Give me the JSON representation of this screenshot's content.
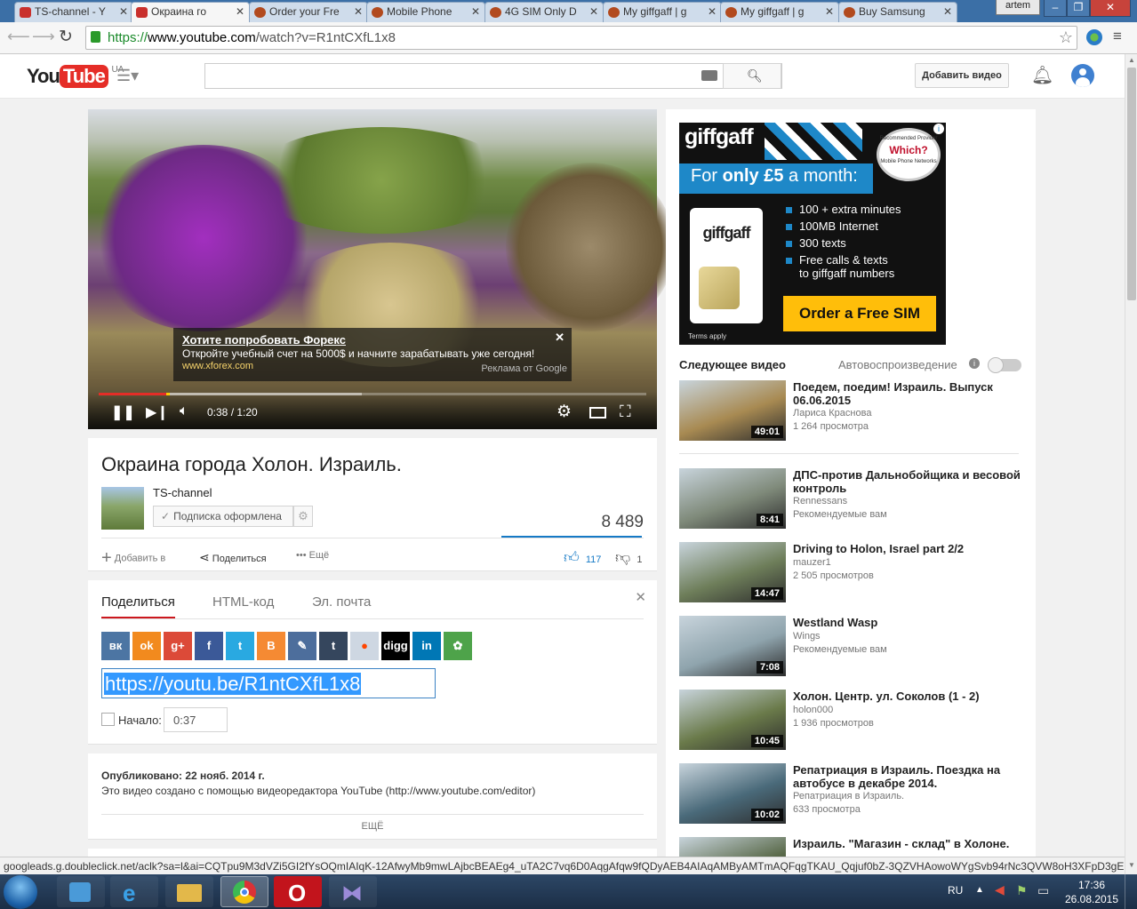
{
  "browser": {
    "tabs": [
      {
        "label": "TS-channel - Y",
        "active": false,
        "icon": "youtube-icon"
      },
      {
        "label": "Окраина го",
        "active": true,
        "icon": "youtube-icon"
      },
      {
        "label": "Order your Fre",
        "active": false,
        "icon": "giffgaff-icon"
      },
      {
        "label": "Mobile Phone",
        "active": false,
        "icon": "giffgaff-icon"
      },
      {
        "label": "4G SIM Only D",
        "active": false,
        "icon": "giffgaff-icon"
      },
      {
        "label": "My giffgaff | g",
        "active": false,
        "icon": "giffgaff-icon"
      },
      {
        "label": "My giffgaff | g",
        "active": false,
        "icon": "giffgaff-icon"
      },
      {
        "label": "Buy Samsung",
        "active": false,
        "icon": "giffgaff-icon"
      }
    ],
    "user": "artem",
    "url_scheme": "https://",
    "url_host": "www.youtube.com",
    "url_path": "/watch?v=R1ntCXfL1x8",
    "status_url": "googleads.g.doubleclick.net/aclk?sa=l&ai=CQTpu9M3dVZi5GI2fYsOQmIAIqK-12AfwyMb9mwLAjbcBEAEg4_uTA2C7vq6D0AqgAfqw9fQDyAEB4AIAqAMByAMTmAQFqgTKAU_Qqjuf0bZ-3QZVHAowoWYgSvb94rNc3QVW8oH3XFpD3gEP..."
  },
  "youtube": {
    "logo_text": "You",
    "logo_tube": "Tube",
    "region": "UA",
    "upload_label": "Добавить видео",
    "video": {
      "title": "Окраина города Холон. Израиль.",
      "channel": "TS-channel",
      "subscribed_label": "Подписка оформлена",
      "views": "8 489",
      "time": "0:38 / 1:20",
      "progress": 0.128,
      "buffered": 0.48,
      "likes": "117",
      "dislikes": "1",
      "add_to": "Добавить в",
      "share": "Поделиться",
      "more": "Ещё"
    },
    "overlay_ad": {
      "title": "Хотите попробовать Форекс",
      "text": "Откройте учебный счет на 5000$ и начните зарабатывать уже сегодня!",
      "url": "www.xforex.com",
      "by": "Реклама от Google"
    },
    "share_panel": {
      "tabs": [
        "Поделиться",
        "HTML-код",
        "Эл. почта"
      ],
      "services": [
        {
          "name": "vk",
          "glyph": "вк",
          "color": "#4c75a3"
        },
        {
          "name": "odnoklassniki",
          "glyph": "ok",
          "color": "#f28a1e"
        },
        {
          "name": "google-plus",
          "glyph": "g+",
          "color": "#dc4a38"
        },
        {
          "name": "facebook",
          "glyph": "f",
          "color": "#3b5998"
        },
        {
          "name": "twitter",
          "glyph": "t",
          "color": "#29a9e1"
        },
        {
          "name": "blogger",
          "glyph": "B",
          "color": "#f58a33"
        },
        {
          "name": "livejournal",
          "glyph": "✎",
          "color": "#4d6e9c"
        },
        {
          "name": "tumblr",
          "glyph": "t",
          "color": "#35465d"
        },
        {
          "name": "reddit",
          "glyph": "●",
          "color": "#ced7e2"
        },
        {
          "name": "digg",
          "glyph": "digg",
          "color": "#000000"
        },
        {
          "name": "linkedin",
          "glyph": "in",
          "color": "#0077b5"
        },
        {
          "name": "stumbleupon",
          "glyph": "✿",
          "color": "#4ea34a"
        }
      ],
      "link": "https://youtu.be/R1ntCXfL1x8",
      "start_label": "Начало:",
      "start_value": "0:37"
    },
    "description": {
      "published": "Опубликовано: 22 нояб. 2014 г.",
      "text": "Это видео создано с помощью видеоредактора YouTube (http://www.youtube.com/editor)",
      "more": "ЕЩЁ"
    },
    "ad": {
      "brand": "giffgaff",
      "headline_pre": "For ",
      "headline_bold": "only £5",
      "headline_post": " a month:",
      "badge_top": "Recommended Provider",
      "badge_mid": "Which?",
      "badge_bottom": "Mobile Phone Networks",
      "bullets": [
        "100 + extra minutes",
        "100MB Internet",
        "300 texts",
        "Free calls & texts"
      ],
      "bullet_extra": "to giffgaff numbers",
      "cta": "Order a Free SIM",
      "terms": "Terms apply"
    },
    "up_next_label": "Следующее видео",
    "autoplay_label": "Автовоспроизведение",
    "related": [
      {
        "title": "Поедем, поедим! Израиль. Выпуск 06.06.2015",
        "channel": "Лариса Краснова",
        "meta": "1 264 просмотра",
        "duration": "49:01",
        "thumb": "#a88a52"
      },
      {
        "title": "ДПС-против Дальнобойщика и весовой контроль",
        "channel": "Rennessans",
        "meta": "Рекомендуемые вам",
        "duration": "8:41",
        "thumb": "#7f8a7a"
      },
      {
        "title": "Driving to Holon, Israel part 2/2",
        "channel": "mauzer1",
        "meta": "2 505 просмотров",
        "duration": "14:47",
        "thumb": "#6e7e5a"
      },
      {
        "title": "Westland Wasp",
        "channel": "Wings",
        "meta": "Рекомендуемые вам",
        "duration": "7:08",
        "thumb": "#8fa4ad"
      },
      {
        "title": "Холон. Центр. ул. Соколов (1 - 2)",
        "channel": "holon000",
        "meta": "1 936 просмотров",
        "duration": "10:45",
        "thumb": "#6a7a4a"
      },
      {
        "title": "Репатриация в Израиль. Поездка на автобусе в декабре 2014.",
        "channel": "Репатриация в Израиль.",
        "meta": "633 просмотра",
        "duration": "10:02",
        "thumb": "#4a6a7a"
      },
      {
        "title": "Израиль. \"Магазин - склад\" в Холоне.",
        "channel": "",
        "meta": "",
        "duration": "",
        "thumb": "#5a6a4a"
      }
    ]
  },
  "taskbar": {
    "lang": "RU",
    "time": "17:36",
    "date": "26.08.2015"
  }
}
